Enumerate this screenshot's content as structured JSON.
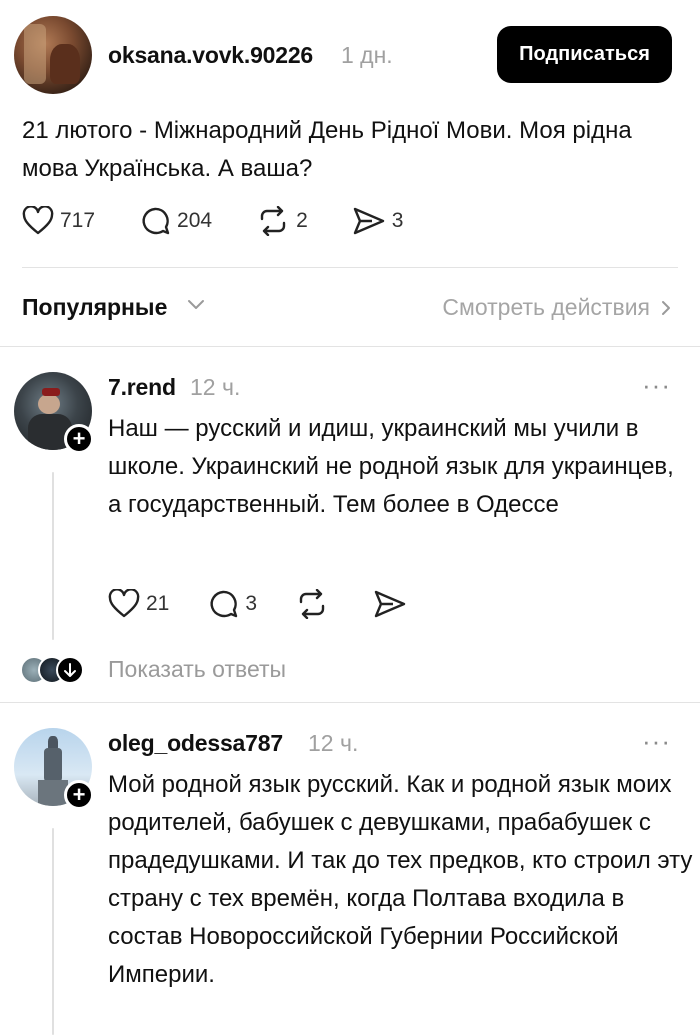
{
  "post": {
    "author": "oksana.vovk.90226",
    "time": "1 дн.",
    "follow_label": "Подписаться",
    "text": "21 лютого - Міжнародний День Рідної Мови. Моя рідна мова Українська. А ваша?",
    "stats": {
      "likes": "717",
      "comments": "204",
      "reposts": "2",
      "shares": "3"
    }
  },
  "sort": {
    "label": "Популярные",
    "view_activity": "Смотреть действия"
  },
  "comments": [
    {
      "author": "7.rend",
      "time": "12 ч.",
      "more": "···",
      "text": "Наш — русский и идиш, украинский мы учили в школе. Украинский не родной язык для украинцев, а государственный. Тем более в Одессе",
      "stats": {
        "likes": "21",
        "comments": "3"
      },
      "show_replies": "Показать ответы"
    },
    {
      "author": "oleg_odessa787",
      "time": "12 ч.",
      "more": "···",
      "text": "Мой родной язык русский. Как и родной язык моих родителей, бабушек с девушками, прабабушек с прадедушками. И так до тех предков, кто строил эту страну с тех времён, когда Полтава входила в состав Новороссийской Губернии Российской Империи."
    }
  ],
  "icons": {
    "like": "heart-icon",
    "comment": "comment-bubble-icon",
    "repost": "repost-icon",
    "share": "send-icon",
    "plus": "plus-icon",
    "more": "more-dots-icon",
    "chevron_down": "chevron-down-icon",
    "chevron_right": "chevron-right-icon",
    "arrow_down": "arrow-down-icon"
  },
  "colors": {
    "primary": "#000000",
    "muted": "#a0a0a0",
    "divider": "#e3e3e3"
  }
}
